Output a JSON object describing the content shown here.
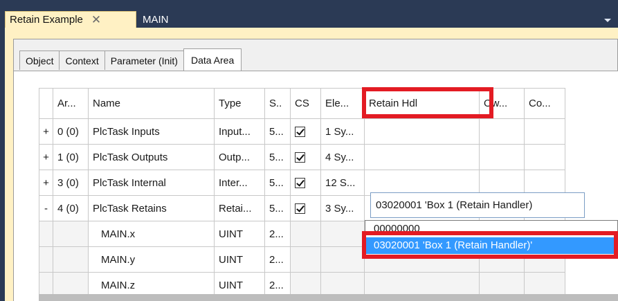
{
  "window": {
    "tabs": [
      {
        "label": "Retain Example",
        "close": "✕",
        "active": true
      },
      {
        "label": "MAIN",
        "active": false
      }
    ]
  },
  "property_tabs": [
    "Object",
    "Context",
    "Parameter (Init)",
    "Data Area"
  ],
  "grid": {
    "columns": [
      "",
      "Ar...",
      "Name",
      "Type",
      "S..",
      "CS",
      "Ele...",
      "Retain Hdl",
      "Ow...",
      "Co..."
    ],
    "rows": [
      {
        "toggle": "+",
        "ar": "0 (0)",
        "name": "PlcTask Inputs",
        "type": "Input...",
        "size": "5...",
        "cs": true,
        "ele": "1 Sy...",
        "retain": "",
        "ow": "",
        "co": ""
      },
      {
        "toggle": "+",
        "ar": "1 (0)",
        "name": "PlcTask Outputs",
        "type": "Outp...",
        "size": "5...",
        "cs": true,
        "ele": "4 Sy...",
        "retain": "",
        "ow": "",
        "co": ""
      },
      {
        "toggle": "+",
        "ar": "3 (0)",
        "name": "PlcTask Internal",
        "type": "Inter...",
        "size": "5...",
        "cs": true,
        "ele": "12 S...",
        "retain": "",
        "ow": "",
        "co": ""
      },
      {
        "toggle": "-",
        "ar": "4 (0)",
        "name": "PlcTask Retains",
        "type": "Retai...",
        "size": "5...",
        "cs": true,
        "ele": "3 Sy...",
        "retain": "",
        "ow": "",
        "co": ""
      },
      {
        "toggle": "",
        "ar": "",
        "name": "MAIN.x",
        "type": "UINT",
        "size": "2...",
        "cs": false,
        "ele": "",
        "retain": "",
        "ow": "",
        "co": ""
      },
      {
        "toggle": "",
        "ar": "",
        "name": "MAIN.y",
        "type": "UINT",
        "size": "2...",
        "cs": false,
        "ele": "",
        "retain": "",
        "ow": "",
        "co": ""
      },
      {
        "toggle": "",
        "ar": "",
        "name": "MAIN.z",
        "type": "UINT",
        "size": "2...",
        "cs": false,
        "ele": "",
        "retain": "",
        "ow": "",
        "co": ""
      }
    ]
  },
  "retain_combo": {
    "value": "03020001 'Box 1 (Retain Handler)",
    "options": [
      "00000000",
      "03020001 'Box 1 (Retain Handler)'"
    ],
    "selected_index": 1
  },
  "colors": {
    "highlight": "#e31b23",
    "selection": "#3399ff",
    "tab_active": "#fff1c4",
    "background": "#2b3a55"
  }
}
